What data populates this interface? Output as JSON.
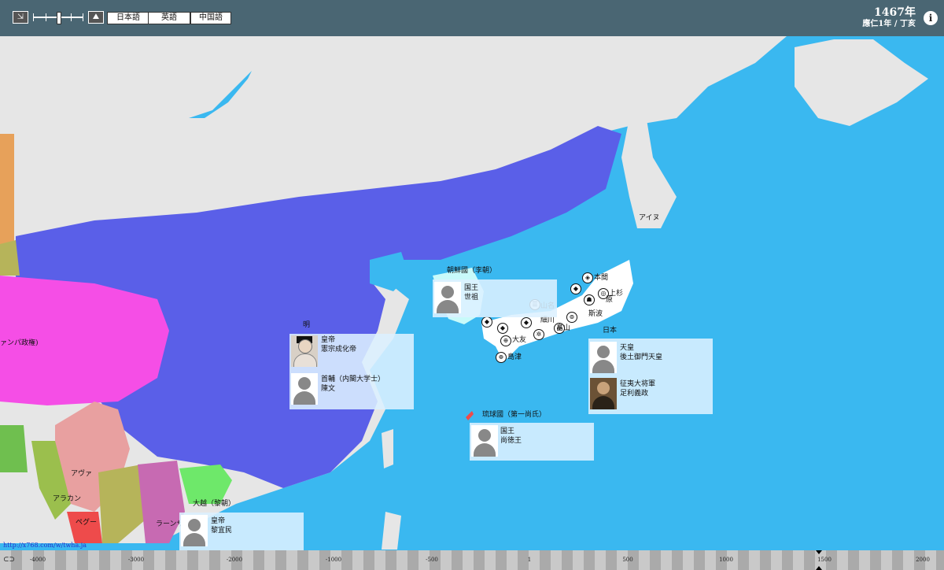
{
  "header": {
    "lang_buttons": [
      "日本語",
      "英語",
      "中国語"
    ],
    "year": "1467年",
    "era": "應仁1年 / 丁亥",
    "zoom_out_icon": "zoom-out-icon",
    "zoom_in_icon": "zoom-in-icon",
    "info_icon": "person-info-icon"
  },
  "colors": {
    "sea": "#3ab8f0",
    "land": "#e8e8e8",
    "ming": "#5a5fe8",
    "japan": "#ffffff",
    "highlight": "#f0f",
    "panel_bg": "#dcf0ff"
  },
  "map_labels": {
    "ming": "明",
    "joseon": "朝鮮國（李朝）",
    "japan": "日本",
    "ainu": "アイヌ",
    "ryukyu": "琉球國（第一尚氏）",
    "dai_viet": "大越（黎朝）",
    "ava": "アヴァ",
    "arakan": "アラカン",
    "pegu": "ペグー",
    "lan_xang": "ラーンサ",
    "champa": "ァンパ政権)",
    "clans": [
      "本間",
      "上杉",
      "原",
      "斯波",
      "畠山",
      "山名",
      "大友",
      "島津",
      "細川"
    ]
  },
  "panels": {
    "ming": [
      {
        "title": "皇帝",
        "name": "憲宗成化帝"
      },
      {
        "title": "首輔（内閣大学士）",
        "name": "陳文"
      }
    ],
    "joseon": [
      {
        "title": "国王",
        "name": "世祖"
      }
    ],
    "japan": [
      {
        "title": "天皇",
        "name": "後土御門天皇"
      },
      {
        "title": "征夷大将軍",
        "name": "足利義政"
      }
    ],
    "ryukyu": [
      {
        "title": "国王",
        "name": "尚徳王"
      }
    ],
    "dai_viet": [
      {
        "title": "皇帝",
        "name": "黎宜民"
      }
    ]
  },
  "footer": {
    "link_text": "http://x768.com/w/twha.ja"
  },
  "timeline": {
    "ticks": [
      "-4000",
      "-3000",
      "-2000",
      "-1000",
      "-500",
      "1",
      "500",
      "1000",
      "1500",
      "2000"
    ],
    "current": "1467"
  }
}
